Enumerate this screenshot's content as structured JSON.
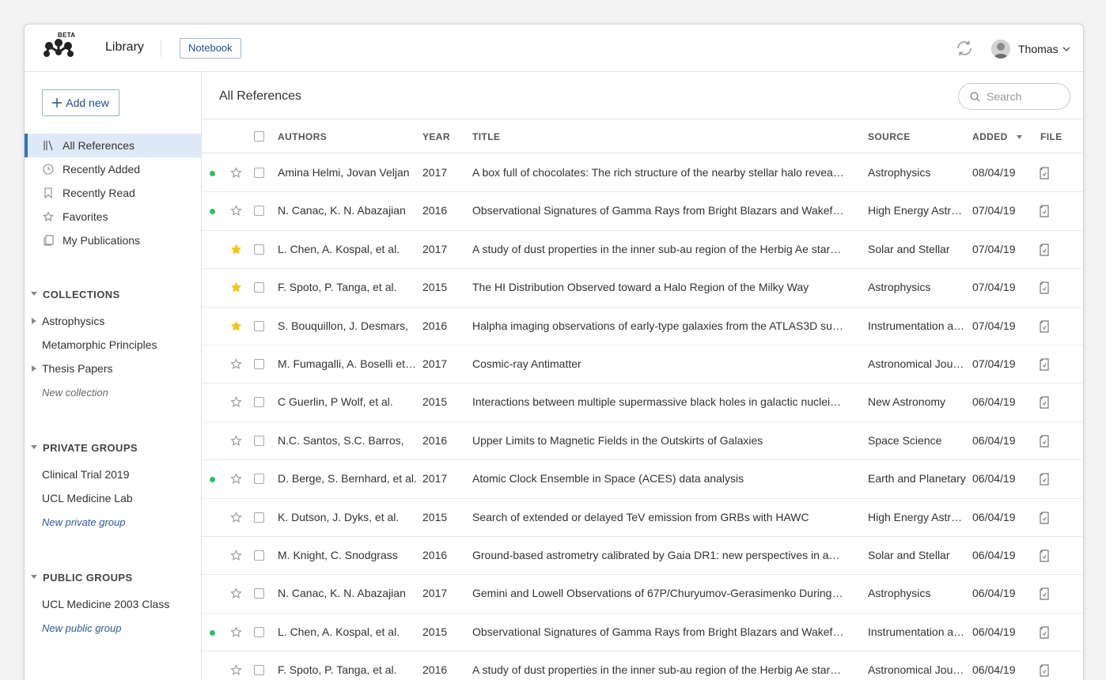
{
  "header": {
    "badge": "BETA",
    "app_title": "Library",
    "notebook_label": "Notebook",
    "user_name": "Thomas"
  },
  "sidebar": {
    "add_new_label": "Add new",
    "nav": [
      {
        "label": "All References",
        "icon": "library-icon",
        "active": true
      },
      {
        "label": "Recently Added",
        "icon": "clock-icon"
      },
      {
        "label": "Recently Read",
        "icon": "bookmark-icon"
      },
      {
        "label": "Favorites",
        "icon": "star-icon"
      },
      {
        "label": "My Publications",
        "icon": "publications-icon"
      }
    ],
    "collections": {
      "heading": "COLLECTIONS",
      "items": [
        "Astrophysics",
        "Metamorphic Principles",
        "Thesis Papers"
      ],
      "new_label": "New collection"
    },
    "private_groups": {
      "heading": "PRIVATE GROUPS",
      "items": [
        "Clinical Trial 2019",
        "UCL Medicine Lab"
      ],
      "new_label": "New private group"
    },
    "public_groups": {
      "heading": "PUBLIC GROUPS",
      "items": [
        "UCL Medicine 2003 Class"
      ],
      "new_label": "New public group"
    }
  },
  "main": {
    "title": "All References",
    "search_placeholder": "Search",
    "columns": {
      "authors": "AUTHORS",
      "year": "YEAR",
      "title": "TITLE",
      "source": "SOURCE",
      "added": "ADDED",
      "file": "FILE"
    },
    "rows": [
      {
        "unread": true,
        "starred": false,
        "authors": "Amina Helmi, Jovan Veljan",
        "year": "2017",
        "title": "A box full of chocolates: The rich structure of the nearby stellar halo revealing…",
        "source": "Astrophysics",
        "added": "08/04/19"
      },
      {
        "unread": true,
        "starred": false,
        "authors": "N. Canac, K. N. Abazajian",
        "year": "2016",
        "title": "Observational Signatures of Gamma Rays from Bright Blazars and Wakefield…",
        "source": "High Energy Astro…",
        "added": "07/04/19"
      },
      {
        "unread": false,
        "starred": true,
        "authors": "L. Chen, A. Kospal, et al.",
        "year": "2017",
        "title": "A study of dust properties in the inner sub-au region of the Herbig Ae star HD…",
        "source": "Solar and Stellar",
        "added": "07/04/19"
      },
      {
        "unread": false,
        "starred": true,
        "authors": "F. Spoto, P. Tanga, et al.",
        "year": "2015",
        "title": "The HI Distribution Observed toward a Halo Region of the Milky Way",
        "source": "Astrophysics",
        "added": "07/04/19"
      },
      {
        "unread": false,
        "starred": true,
        "authors": "S. Bouquillon, J. Desmars,",
        "year": "2016",
        "title": "Halpha imaging observations of early-type galaxies from the ATLAS3D survey",
        "source": "Instrumentation an…",
        "added": "07/04/19"
      },
      {
        "unread": false,
        "starred": false,
        "authors": "M. Fumagalli, A. Boselli et al.",
        "year": "2017",
        "title": "Cosmic-ray Antimatter",
        "source": "Astronomical Jour…",
        "added": "07/04/19"
      },
      {
        "unread": false,
        "starred": false,
        "authors": "C Guerlin, P Wolf, et al.",
        "year": "2015",
        "title": "Interactions between multiple supermassive black holes in galactic nuclei: a s…",
        "source": "New Astronomy",
        "added": "06/04/19"
      },
      {
        "unread": false,
        "starred": false,
        "authors": "N.C. Santos, S.C. Barros,",
        "year": "2016",
        "title": "Upper Limits to Magnetic Fields in the Outskirts of Galaxies",
        "source": "Space Science",
        "added": "06/04/19"
      },
      {
        "unread": true,
        "starred": false,
        "authors": "D. Berge, S. Bernhard, et al.",
        "year": "2017",
        "title": "Atomic Clock Ensemble in Space (ACES) data analysis",
        "source": "Earth and Planetary",
        "added": "06/04/19"
      },
      {
        "unread": false,
        "starred": false,
        "authors": "K. Dutson, J. Dyks, et al.",
        "year": "2015",
        "title": "Search of extended or delayed TeV emission from GRBs with HAWC",
        "source": "High Energy Astro…",
        "added": "06/04/19"
      },
      {
        "unread": false,
        "starred": false,
        "authors": "M. Knight, C. Snodgrass",
        "year": "2016",
        "title": "Ground-based astrometry calibrated by Gaia DR1: new perspectives in astero…",
        "source": "Solar and Stellar",
        "added": "06/04/19"
      },
      {
        "unread": false,
        "starred": false,
        "authors": "N. Canac, K. N. Abazajian",
        "year": "2017",
        "title": "Gemini and Lowell Observations of 67P/Churyumov-Gerasimenko During the…",
        "source": "Astrophysics",
        "added": "06/04/19"
      },
      {
        "unread": true,
        "starred": false,
        "authors": "L. Chen, A. Kospal, et al.",
        "year": "2015",
        "title": "Observational Signatures of Gamma Rays from Bright Blazars and Wakefield…",
        "source": "Instrumentation an…",
        "added": "06/04/19"
      },
      {
        "unread": false,
        "starred": false,
        "authors": "F. Spoto, P. Tanga, et al.",
        "year": "2016",
        "title": "A study of dust properties in the inner sub-au region of the Herbig Ae star HD…",
        "source": "Astronomical Jour…",
        "added": "06/04/19"
      }
    ]
  },
  "colors": {
    "accent": "#3a6fb5",
    "active_bg": "#dde9f6",
    "unread_dot": "#2bbf6a",
    "star_filled": "#f0c419",
    "link": "#2d5c97"
  }
}
